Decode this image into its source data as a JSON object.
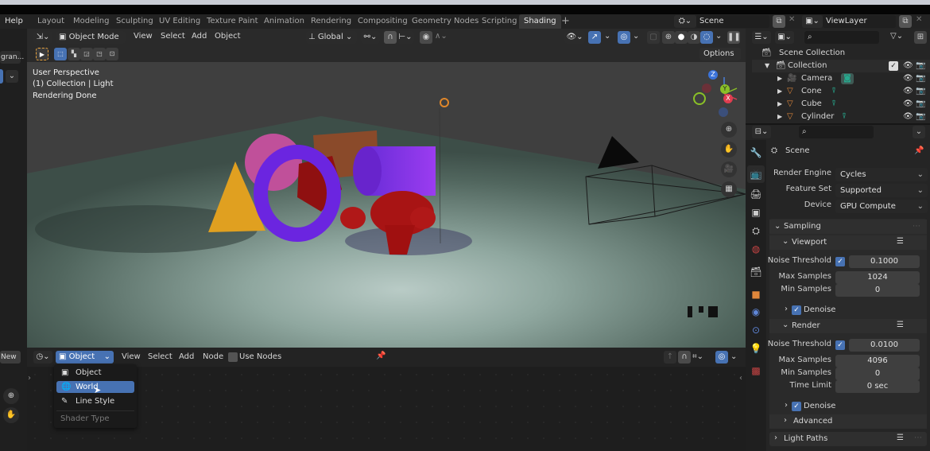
{
  "menubar": {
    "help": "Help",
    "workspaces": [
      "Layout",
      "Modeling",
      "Sculpting",
      "UV Editing",
      "Texture Paint",
      "Animation",
      "Rendering",
      "Compositing",
      "Geometry Nodes",
      "Scripting",
      "Shading"
    ],
    "active_workspace": "Shading",
    "add_workspace": "+",
    "scene_name": "Scene",
    "view_layer": "ViewLayer"
  },
  "left_edge": {
    "truncated_label": "gran...",
    "new_label": "New"
  },
  "viewport": {
    "mode": "Object Mode",
    "menus": [
      "View",
      "Select",
      "Add",
      "Object"
    ],
    "orientation": "Global",
    "options_label": "Options",
    "overlay_text": [
      "User Perspective",
      "(1) Collection | Light",
      "Rendering Done"
    ],
    "gizmo_axes": [
      "Z",
      "Y",
      "X"
    ]
  },
  "node_editor": {
    "type_dropdown": "Object",
    "menus": [
      "View",
      "Select",
      "Add",
      "Node"
    ],
    "use_nodes_label": "Use Nodes",
    "use_nodes_checked": false,
    "popup": {
      "items": [
        {
          "label": "Object",
          "icon": "object-icon",
          "selected": false
        },
        {
          "label": "World",
          "icon": "world-icon",
          "selected": true
        },
        {
          "label": "Line Style",
          "icon": "line-style-icon",
          "selected": false
        }
      ],
      "footer": "Shader Type"
    }
  },
  "outliner": {
    "search_placeholder": "",
    "root": "Scene Collection",
    "collection": "Collection",
    "items": [
      {
        "name": "Camera",
        "type": "camera"
      },
      {
        "name": "Cone",
        "type": "mesh"
      },
      {
        "name": "Cube",
        "type": "mesh"
      },
      {
        "name": "Cylinder",
        "type": "mesh"
      }
    ]
  },
  "properties": {
    "context": "Scene",
    "render_engine_label": "Render Engine",
    "render_engine": "Cycles",
    "feature_set_label": "Feature Set",
    "feature_set": "Supported",
    "device_label": "Device",
    "device": "GPU Compute",
    "sampling": {
      "title": "Sampling",
      "viewport": {
        "title": "Viewport",
        "noise_threshold_label": "Noise Threshold",
        "noise_threshold_enabled": true,
        "noise_threshold": "0.1000",
        "max_samples_label": "Max Samples",
        "max_samples": "1024",
        "min_samples_label": "Min Samples",
        "min_samples": "0",
        "denoise_label": "Denoise",
        "denoise": true
      },
      "render": {
        "title": "Render",
        "noise_threshold_label": "Noise Threshold",
        "noise_threshold_enabled": true,
        "noise_threshold": "0.0100",
        "max_samples_label": "Max Samples",
        "max_samples": "4096",
        "min_samples_label": "Min Samples",
        "min_samples": "0",
        "time_limit_label": "Time Limit",
        "time_limit": "0 sec",
        "denoise_label": "Denoise",
        "denoise": true
      },
      "advanced": "Advanced"
    },
    "light_paths": "Light Paths"
  },
  "colors": {
    "accent": "#4772b3",
    "mesh_icon": "#e0873b",
    "data_icon": "#27a98e"
  }
}
